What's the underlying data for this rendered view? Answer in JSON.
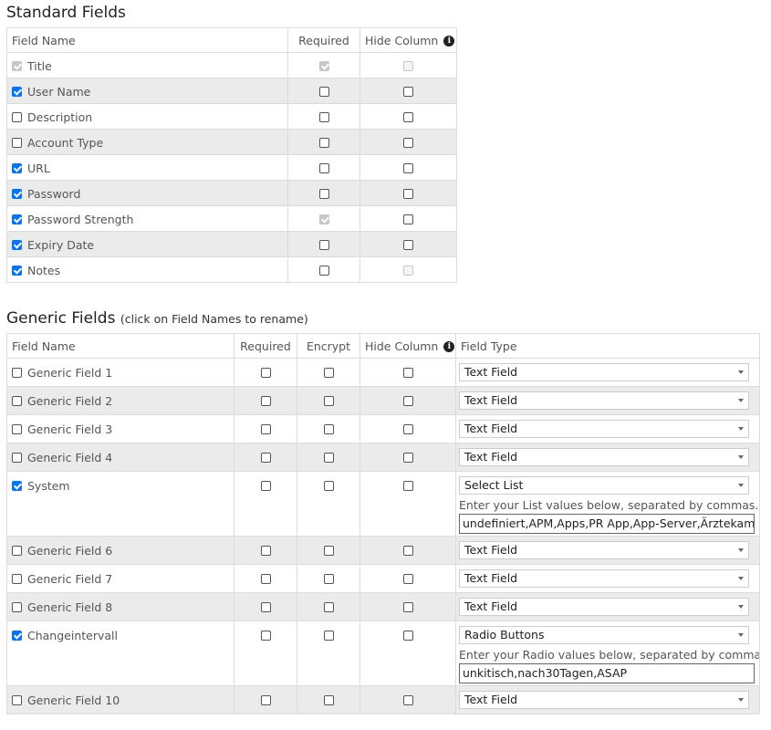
{
  "standard": {
    "title": "Standard Fields",
    "headers": {
      "field_name": "Field Name",
      "required": "Required",
      "hide_column": "Hide Column"
    },
    "rows": [
      {
        "label": "Title",
        "enabled": true,
        "required": true,
        "hide": false,
        "enabled_disabled": true,
        "required_disabled": true,
        "hide_disabled": true
      },
      {
        "label": "User Name",
        "enabled": true,
        "required": false,
        "hide": false
      },
      {
        "label": "Description",
        "enabled": false,
        "required": false,
        "hide": false
      },
      {
        "label": "Account Type",
        "enabled": false,
        "required": false,
        "hide": false
      },
      {
        "label": "URL",
        "enabled": true,
        "required": false,
        "hide": false
      },
      {
        "label": "Password",
        "enabled": true,
        "required": false,
        "hide": false
      },
      {
        "label": "Password Strength",
        "enabled": true,
        "required": true,
        "hide": false,
        "required_disabled": true
      },
      {
        "label": "Expiry Date",
        "enabled": true,
        "required": false,
        "hide": false
      },
      {
        "label": "Notes",
        "enabled": true,
        "required": false,
        "hide": false,
        "hide_disabled": true
      }
    ]
  },
  "generic": {
    "title": "Generic Fields",
    "subtitle": "(click on Field Names to rename)",
    "headers": {
      "field_name": "Field Name",
      "required": "Required",
      "encrypt": "Encrypt",
      "hide_column": "Hide Column",
      "field_type": "Field Type"
    },
    "rows": [
      {
        "label": "Generic Field 1",
        "enabled": false,
        "type": "Text Field"
      },
      {
        "label": "Generic Field 2",
        "enabled": false,
        "type": "Text Field"
      },
      {
        "label": "Generic Field 3",
        "enabled": false,
        "type": "Text Field"
      },
      {
        "label": "Generic Field 4",
        "enabled": false,
        "type": "Text Field"
      },
      {
        "label": "System",
        "enabled": true,
        "type": "Select List",
        "hint": "Enter your List values below, separated by commas.",
        "values": "undefiniert,APM,Apps,PR App,App-Server,Ärztekammer"
      },
      {
        "label": "Generic Field 6",
        "enabled": false,
        "type": "Text Field"
      },
      {
        "label": "Generic Field 7",
        "enabled": false,
        "type": "Text Field"
      },
      {
        "label": "Generic Field 8",
        "enabled": false,
        "type": "Text Field"
      },
      {
        "label": "Changeintervall",
        "enabled": true,
        "type": "Radio Buttons",
        "hint": "Enter your Radio values below, separated by commas.",
        "values": "unkitisch,nach30Tagen,ASAP"
      },
      {
        "label": "Generic Field 10",
        "enabled": false,
        "type": "Text Field"
      }
    ]
  },
  "icons": {
    "info": "info-icon",
    "caret": "chevron-down-icon"
  },
  "colors": {
    "checkbox_checked": "#0075ff",
    "row_alt": "#ebebeb",
    "border": "#dcdcdc"
  }
}
